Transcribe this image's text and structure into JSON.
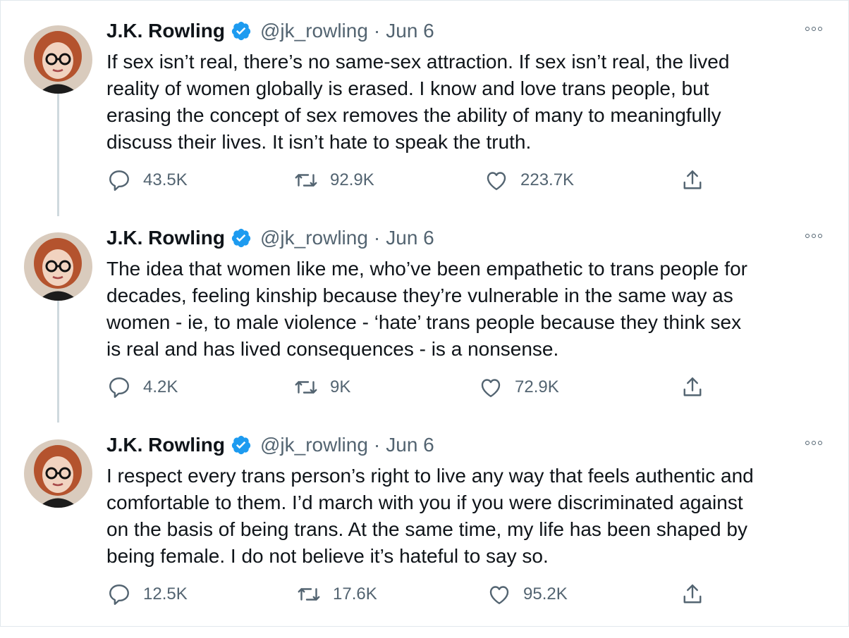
{
  "tweets": [
    {
      "name": "J.K. Rowling",
      "handle": "@jk_rowling",
      "date": "Jun 6",
      "lines": [
        "If sex isn’t real, there’s no same-sex attraction. If sex isn’t real, the lived",
        "reality of women globally is erased. I know and love trans people, but",
        "erasing the concept of sex removes the ability of many to meaningfully",
        "discuss their lives. It isn’t hate to speak the truth."
      ],
      "replies": "43.5K",
      "retweets": "92.9K",
      "likes": "223.7K"
    },
    {
      "name": "J.K. Rowling",
      "handle": "@jk_rowling",
      "date": "Jun 6",
      "lines": [
        "The idea that women like me, who’ve been empathetic to trans people for",
        "decades, feeling kinship because they’re vulnerable in the same way as",
        "women - ie, to male violence - ‘hate’ trans people because they think sex",
        "is real and has lived consequences - is a nonsense."
      ],
      "replies": "4.2K",
      "retweets": "9K",
      "likes": "72.9K"
    },
    {
      "name": "J.K. Rowling",
      "handle": "@jk_rowling",
      "date": "Jun 6",
      "lines": [
        "I respect every trans person’s right to live any way that feels authentic and",
        "comfortable to them. I’d march with you if you were discriminated against",
        "on the basis of being trans. At the same time, my life has been shaped by",
        "being female. I do not believe it’s hateful to say so."
      ],
      "replies": "12.5K",
      "retweets": "17.6K",
      "likes": "95.2K"
    }
  ],
  "icons": {
    "verified": "verified-badge-icon",
    "more": "more-options-icon",
    "reply": "reply-icon",
    "retweet": "retweet-icon",
    "like": "heart-icon",
    "share": "share-icon"
  },
  "colors": {
    "verified": "#1d9bf0",
    "muted_text": "#536471",
    "body_text": "#0f1419",
    "thread_line": "#cfd9de"
  }
}
